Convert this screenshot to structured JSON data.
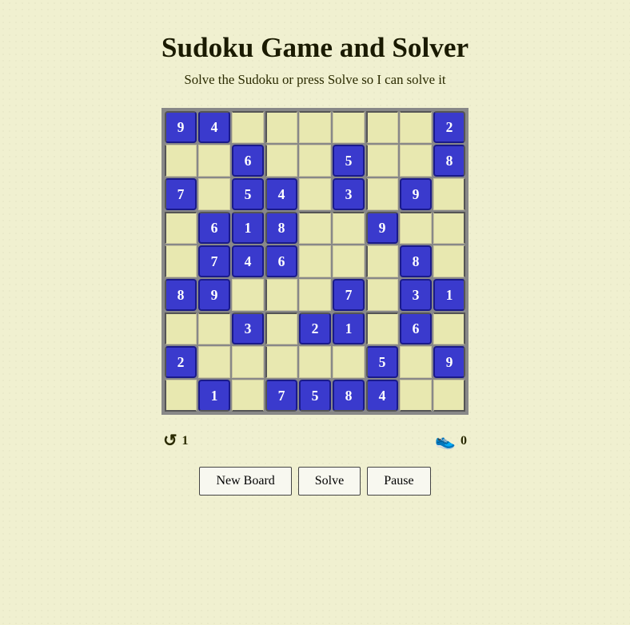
{
  "title": "Sudoku Game and Solver",
  "subtitle": "Solve the Sudoku or press Solve so I can solve it",
  "stats": {
    "undo_count": "1",
    "score": "0"
  },
  "buttons": {
    "new_board": "New Board",
    "solve": "Solve",
    "pause": "Pause"
  },
  "grid": [
    [
      9,
      4,
      0,
      0,
      0,
      0,
      0,
      0,
      2
    ],
    [
      0,
      0,
      6,
      0,
      0,
      5,
      0,
      0,
      8
    ],
    [
      7,
      0,
      5,
      4,
      0,
      3,
      0,
      9,
      0
    ],
    [
      0,
      6,
      1,
      8,
      0,
      0,
      9,
      0,
      0
    ],
    [
      0,
      7,
      4,
      6,
      0,
      0,
      0,
      8,
      0
    ],
    [
      8,
      9,
      0,
      0,
      0,
      7,
      0,
      3,
      1
    ],
    [
      0,
      0,
      3,
      0,
      2,
      1,
      0,
      6,
      0
    ],
    [
      2,
      0,
      0,
      0,
      0,
      0,
      5,
      0,
      9
    ],
    [
      0,
      1,
      0,
      7,
      5,
      8,
      4,
      0,
      0
    ]
  ]
}
